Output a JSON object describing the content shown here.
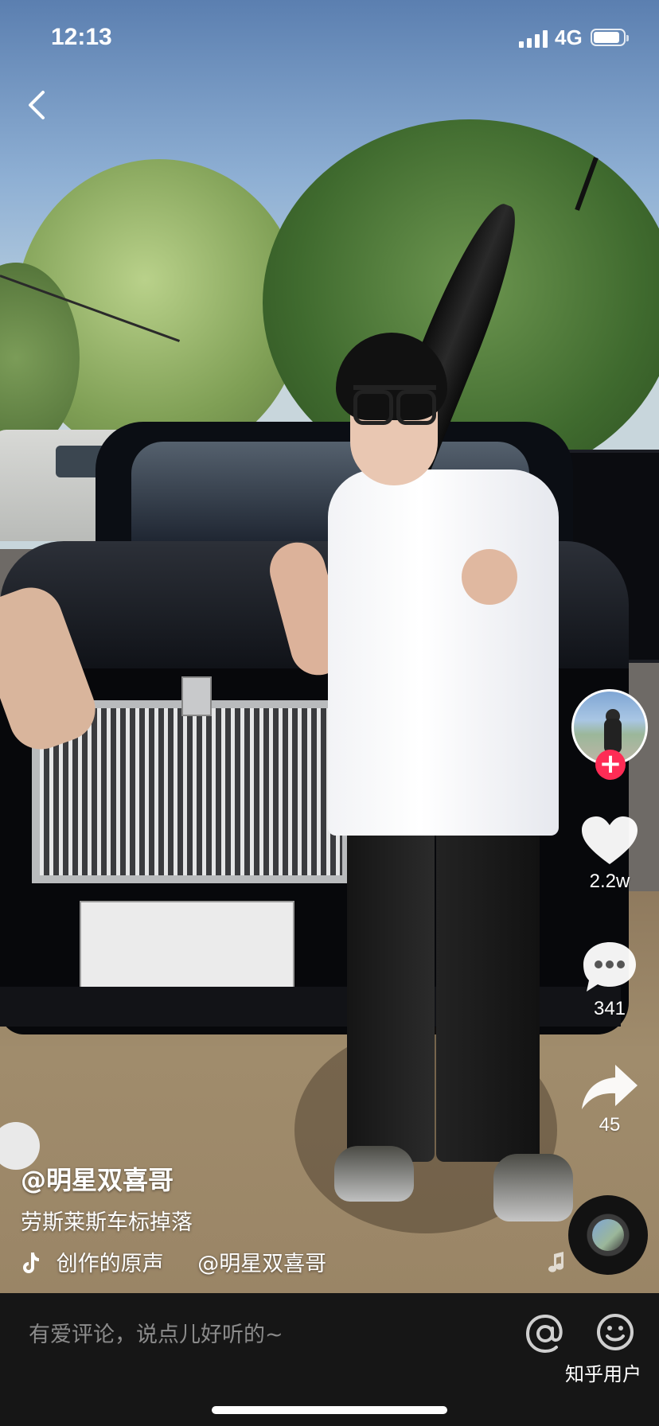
{
  "status_bar": {
    "time": "12:13",
    "network": "4G",
    "signal_bars": 4,
    "battery_level": 0.9
  },
  "nav": {
    "back_icon": "chevron-left-icon"
  },
  "sidebar": {
    "avatar_icon": "user-avatar",
    "follow_icon": "plus-icon",
    "like_count": "2.2w",
    "comment_count": "341",
    "share_count": "45",
    "music_disc_icon": "music-disc-icon"
  },
  "video_info": {
    "author": "@明星双喜哥",
    "description": "劳斯莱斯车标掉落",
    "sound_title": "创作的原声",
    "sound_author": "@明星双喜哥"
  },
  "comment_bar": {
    "placeholder": "有爱评论，说点儿好听的~",
    "at_icon": "at-icon",
    "emoji_icon": "emoji-icon"
  },
  "watermark": "知乎用户",
  "colors": {
    "follow_badge": "#fe2c55",
    "comment_bar_bg": "#161616",
    "placeholder_text": "#8b8b8b"
  }
}
